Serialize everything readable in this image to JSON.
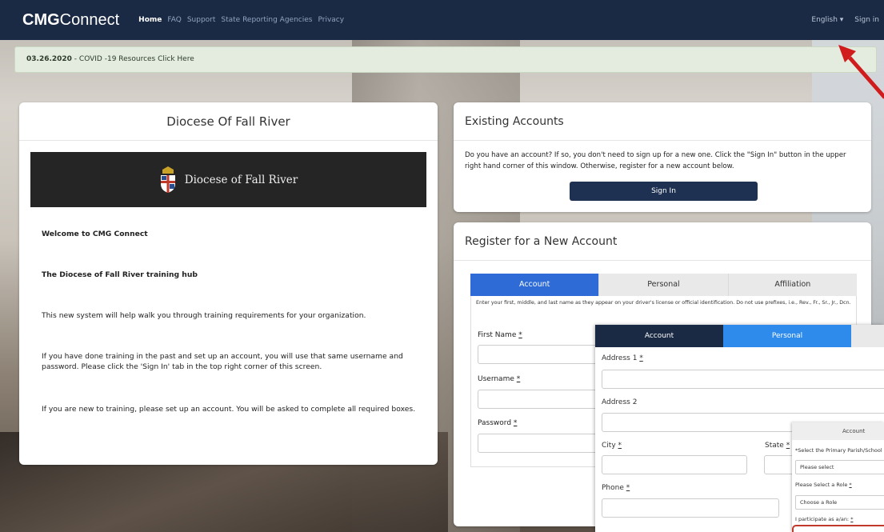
{
  "navbar": {
    "brand_bold": "CMG",
    "brand_light": "Connect",
    "links": [
      "Home",
      "FAQ",
      "Support",
      "State Reporting Agencies",
      "Privacy"
    ],
    "language": "English ▾",
    "sign_in": "Sign in"
  },
  "alert": {
    "date": "03.26.2020",
    "text": " - COVID -19 Resources ",
    "link": "Click Here"
  },
  "left": {
    "title": "Diocese Of Fall River",
    "banner_text": "Diocese of Fall River",
    "p1": "Welcome to CMG Connect",
    "p2": "The Diocese of Fall River training hub",
    "p3": "This new system will help walk you through training requirements for your organization.",
    "p4": "If you have done training in the past and set up an account, you will use that same username and password.  Please click the 'Sign In' tab in the top right corner of this screen.",
    "p5": "If you are new to training, please set up an account.  You will be asked to complete all required boxes."
  },
  "existing": {
    "title": "Existing Accounts",
    "text": "Do you have an account? If so, you don't need to sign up for a new one. Click the \"Sign In\" button in the upper right hand corner of this window. Otherwise, register for a new account below.",
    "button": "Sign In"
  },
  "register": {
    "title": "Register for a New Account",
    "tabs": [
      "Account",
      "Personal",
      "Affiliation"
    ],
    "instructions": "Enter your first, middle, and last name as they appear on your driver's license or official identification. Do not use prefixes, i.e., Rev., Fr., Sr., Jr., Dcn.",
    "first_name": "First Name",
    "username": "Username",
    "password": "Password",
    "required": "*"
  },
  "overlay_personal": {
    "tabs": [
      "Account",
      "Personal"
    ],
    "address1": "Address 1",
    "address2": "Address 2",
    "city": "City",
    "state": "State",
    "phone": "Phone",
    "required": "*"
  },
  "overlay_affiliation": {
    "tab": "Account",
    "parish_label": "*Select the Primary Parish/School",
    "parish_value": "Please select",
    "role_label": "Please Select a Role",
    "role_value": "Choose a Role",
    "participate_label": "I participate as a/an:",
    "required": "*"
  },
  "colors": {
    "navbar": "#1b2a44",
    "accent_tab": "#2e6bd6",
    "personal_tab": "#2e8bec",
    "arrow": "#d01c1c"
  }
}
